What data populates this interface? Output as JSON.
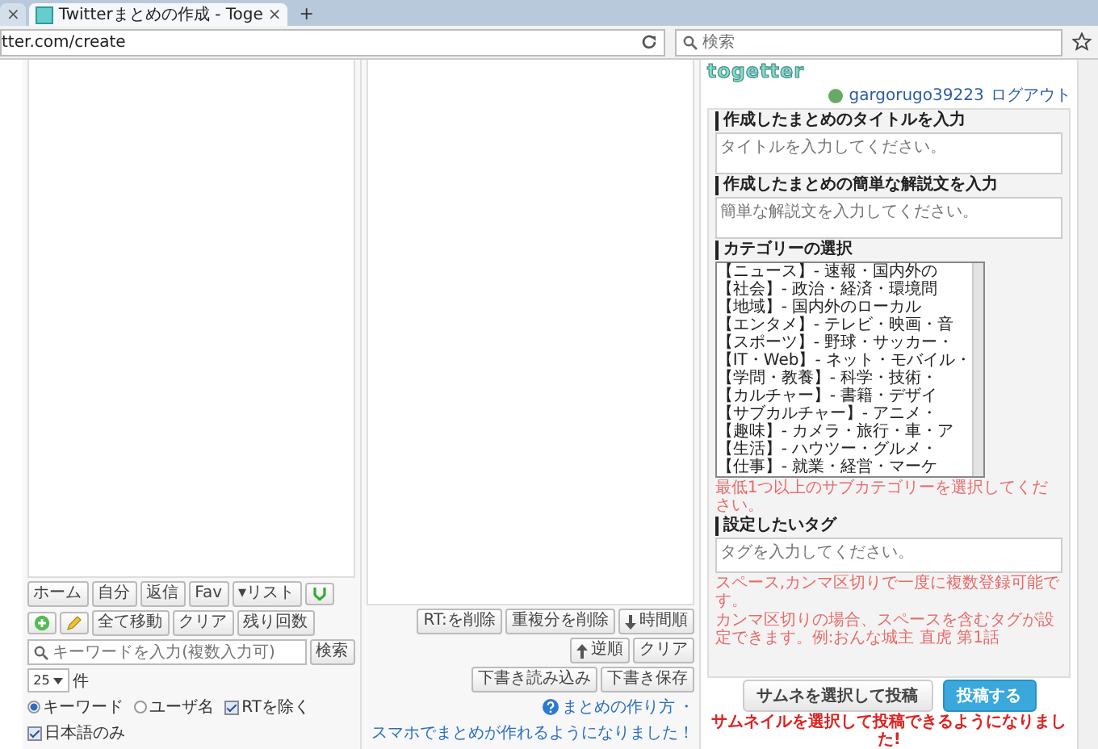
{
  "browser": {
    "tabs": [
      {
        "close": "×",
        "selected": false
      },
      {
        "title": "Twitterまとめの作成 - Toge",
        "close": "×",
        "selected": true
      }
    ],
    "new_tab": "+",
    "address": "tter.com/create",
    "search_placeholder": "検索"
  },
  "left_panel": {
    "timeline_buttons": [
      "ホーム",
      "自分",
      "返信",
      "Fav",
      "▾リスト"
    ],
    "action_buttons": [
      "全て移動",
      "クリア",
      "残り回数"
    ],
    "search": {
      "placeholder": "キーワードを入力(複数入力可)",
      "button": "検索",
      "count": "25",
      "count_unit": "件"
    },
    "options": [
      {
        "kind": "radio",
        "label": "キーワード",
        "selected": true
      },
      {
        "kind": "radio",
        "label": "ユーザ名",
        "selected": false
      },
      {
        "kind": "checkbox",
        "label": "RTを除く",
        "checked": true
      },
      {
        "kind": "checkbox",
        "label": "日本語のみ",
        "checked": true
      }
    ]
  },
  "middle_panel": {
    "buttons": [
      {
        "kind": "plain",
        "label": "RT:を削除"
      },
      {
        "kind": "plain",
        "label": "重複分を削除"
      },
      {
        "kind": "sort-down",
        "label": "時間順"
      },
      {
        "kind": "sort-up",
        "label": "逆順"
      },
      {
        "kind": "plain",
        "label": "クリア"
      }
    ],
    "draft_buttons": [
      "下書き読み込み",
      "下書き保存"
    ],
    "help_links": [
      "まとめの作り方",
      "スマホでまとめが作れるようになりました！"
    ],
    "help_separator": "・"
  },
  "sidebar": {
    "logo": "togetter",
    "user": "gargorugo39223",
    "logout": "ログアウト",
    "title_section": {
      "heading": "作成したまとめのタイトルを入力",
      "placeholder": "タイトルを入力してください。"
    },
    "description_section": {
      "heading": "作成したまとめの簡単な解説文を入力",
      "placeholder": "簡単な解説文を入力してください。"
    },
    "category_section": {
      "heading": "カテゴリーの選択",
      "categories": [
        "【ニュース】- 速報・国内外の",
        "【社会】- 政治・経済・環境問",
        "【地域】- 国内外のローカル",
        "【エンタメ】- テレビ・映画・音",
        "【スポーツ】- 野球・サッカー・",
        "【IT・Web】- ネット・モバイル・",
        "【学問・教養】- 科学・技術・",
        "【カルチャー】- 書籍・デザイ",
        "【サブカルチャー】- アニメ・",
        "【趣味】- カメラ・旅行・車・ア",
        "【生活】- ハウツー・グルメ・",
        "【仕事】- 就業・経営・マーケ"
      ],
      "error": "最低1つ以上のサブカテゴリーを選択してください。"
    },
    "tag_section": {
      "heading": "設定したいタグ",
      "placeholder": "タグを入力してください。",
      "notes": [
        "スペース,カンマ区切りで一度に複数登録可能です。",
        "カンマ区切りの場合、スペースを含むタグが設定できます。例:おんな城主 直虎 第1話"
      ]
    },
    "thumbnail_button": "サムネを選択して投稿",
    "post_button": "投稿する",
    "thumbnail_note": "サムネイルを選択して投稿できるようになりました!"
  }
}
